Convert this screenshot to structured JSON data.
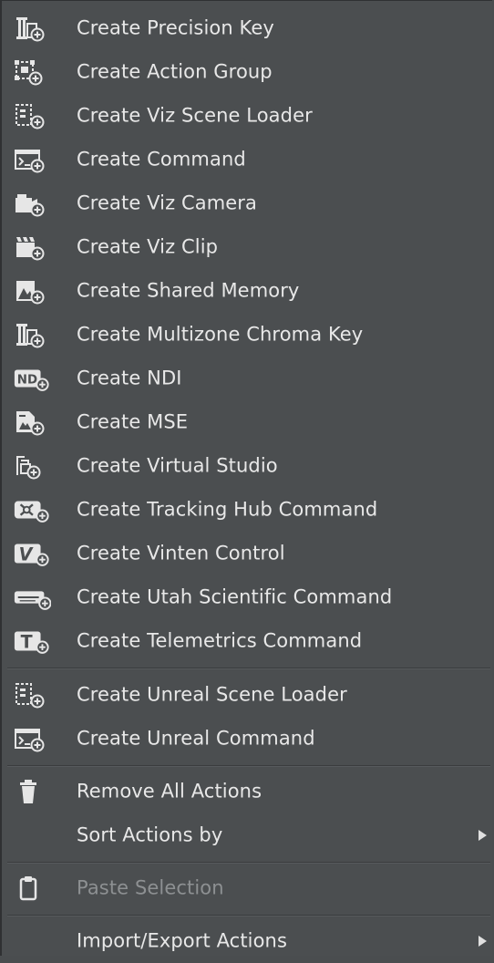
{
  "menu": {
    "items": [
      {
        "label": "Create Precision Key",
        "icon": "precision-key-icon"
      },
      {
        "label": "Create Action Group",
        "icon": "action-group-icon"
      },
      {
        "label": "Create Viz Scene Loader",
        "icon": "scene-loader-icon"
      },
      {
        "label": "Create Command",
        "icon": "command-terminal-icon"
      },
      {
        "label": "Create Viz Camera",
        "icon": "camera-icon"
      },
      {
        "label": "Create Viz Clip",
        "icon": "clapperboard-icon"
      },
      {
        "label": "Create Shared Memory",
        "icon": "shared-memory-icon"
      },
      {
        "label": "Create Multizone Chroma Key",
        "icon": "chroma-key-icon"
      },
      {
        "label": "Create NDI",
        "icon": "ndi-icon"
      },
      {
        "label": "Create MSE",
        "icon": "mse-icon"
      },
      {
        "label": "Create Virtual Studio",
        "icon": "virtual-studio-icon"
      },
      {
        "label": "Create Tracking Hub Command",
        "icon": "tracking-hub-icon"
      },
      {
        "label": "Create Vinten Control",
        "icon": "vinten-icon"
      },
      {
        "label": "Create Utah Scientific Command",
        "icon": "utah-scientific-icon"
      },
      {
        "label": "Create Telemetrics Command",
        "icon": "telemetrics-icon"
      },
      {
        "label": "Create Unreal Scene Loader",
        "icon": "unreal-scene-loader-icon"
      },
      {
        "label": "Create Unreal Command",
        "icon": "unreal-command-icon"
      },
      {
        "label": "Remove All Actions",
        "icon": "trash-icon"
      },
      {
        "label": "Sort Actions by",
        "icon": ""
      },
      {
        "label": "Paste Selection",
        "icon": "clipboard-icon"
      },
      {
        "label": "Import/Export Actions",
        "icon": ""
      }
    ]
  },
  "icon_badge_glyph": "+",
  "ndi_text": "ND",
  "vinten_text": "V",
  "telemetrics_text": "T",
  "colors": {
    "background": "#4b4e50",
    "text": "#e8e8e8",
    "disabled_text": "#8d9092",
    "icon": "#e6e6e6"
  }
}
